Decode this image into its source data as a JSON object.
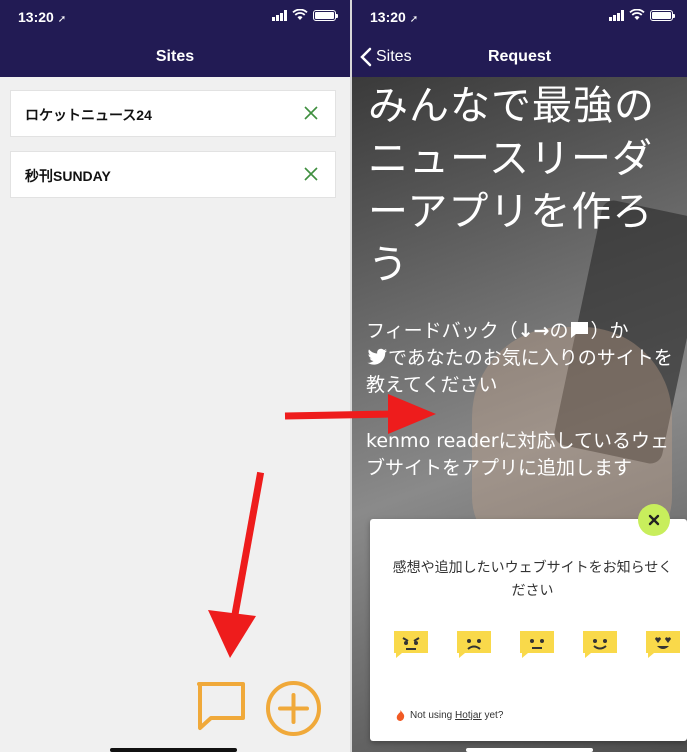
{
  "left": {
    "status_time": "13:20",
    "nav_title": "Sites",
    "sites": [
      {
        "name": "ロケットニュース24"
      },
      {
        "name": "秒刊SUNDAY"
      }
    ],
    "remove_icon": "close-x-icon",
    "feedback_icon": "chat-bubble-icon",
    "add_icon": "plus-circle-icon"
  },
  "right": {
    "status_time": "13:20",
    "back_label": "Sites",
    "nav_title": "Request",
    "hero_title": "みんなで最強のニュースリーダーアプリを作ろう",
    "hero_p1_a": "フィードバック（",
    "hero_p1_arrows": "↓→",
    "hero_p1_b": "の",
    "hero_p1_c": "）か",
    "hero_p1_d": "であなたのお気に入りのサイトを教えてください",
    "hero_p2": "kenmo readerに対応しているウェブサイトをアプリに追加します",
    "modal": {
      "question": "感想や追加したいウェブサイトをお知らせください",
      "ratings": [
        "angry",
        "sad",
        "neutral",
        "happy",
        "love"
      ],
      "footer_prefix": "Not using ",
      "footer_link": "Hotjar",
      "footer_suffix": " yet?"
    }
  },
  "colors": {
    "nav_bg": "#221b54",
    "accent_orange": "#f0a93a",
    "x_green": "#3f8f3f",
    "arrow_red": "#ee1c1c",
    "close_green": "#c8ee5c",
    "emoji_yellow": "#f9d94a"
  }
}
